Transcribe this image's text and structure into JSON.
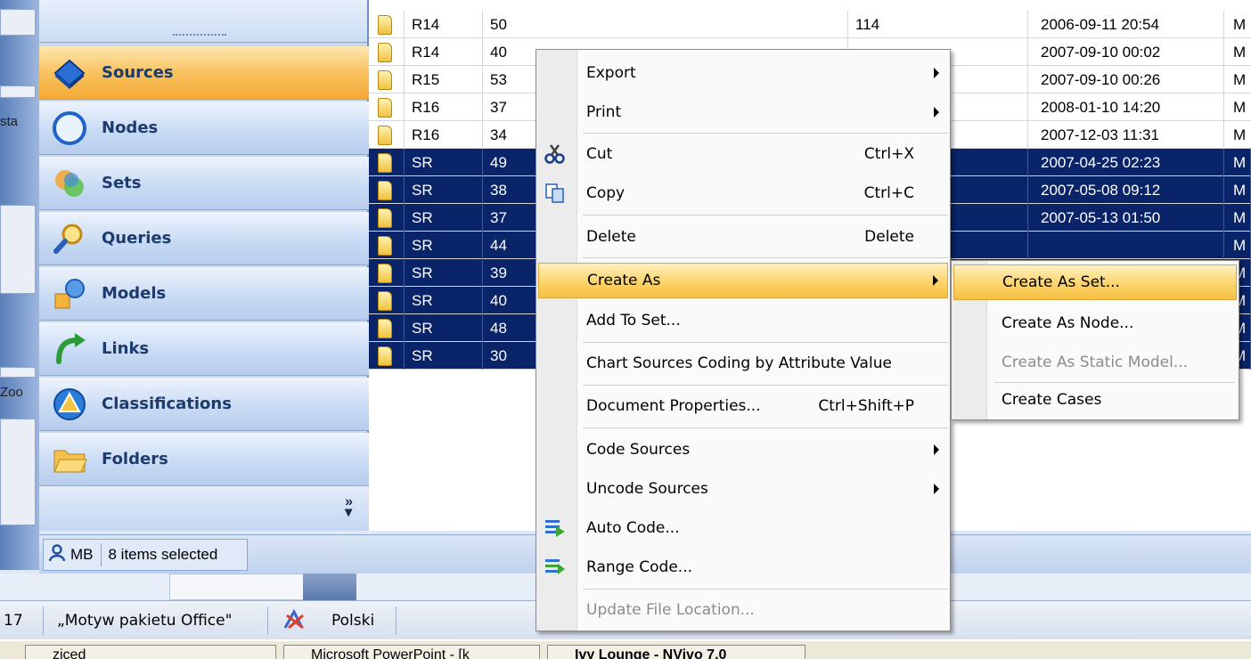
{
  "nav": {
    "items": [
      {
        "label": "Sources",
        "icon": "sources-icon",
        "active": true
      },
      {
        "label": "Nodes",
        "icon": "nodes-icon"
      },
      {
        "label": "Sets",
        "icon": "sets-icon"
      },
      {
        "label": "Queries",
        "icon": "queries-icon"
      },
      {
        "label": "Models",
        "icon": "models-icon"
      },
      {
        "label": "Links",
        "icon": "links-icon"
      },
      {
        "label": "Classifications",
        "icon": "classifications-icon"
      },
      {
        "label": "Folders",
        "icon": "folders-icon"
      }
    ],
    "more_chevron": "»"
  },
  "status": {
    "user": "MB",
    "selection": "8 items selected"
  },
  "grid": {
    "rows": [
      {
        "name": "R14",
        "num": "50",
        "refs": "114",
        "date": "2006-09-11 20:54",
        "by": "M",
        "selected": false
      },
      {
        "name": "R14",
        "num": "40",
        "refs": "",
        "date": "2007-09-10 00:02",
        "by": "M",
        "selected": false
      },
      {
        "name": "R15",
        "num": "53",
        "refs": "",
        "date": "2007-09-10 00:26",
        "by": "M",
        "selected": false
      },
      {
        "name": "R16",
        "num": "37",
        "refs": "",
        "date": "2008-01-10 14:20",
        "by": "M",
        "selected": false
      },
      {
        "name": "R16",
        "num": "34",
        "refs": "",
        "date": "2007-12-03 11:31",
        "by": "M",
        "selected": false
      },
      {
        "name": "SR",
        "num": "49",
        "refs": "",
        "date": "2007-04-25 02:23",
        "by": "M",
        "selected": true
      },
      {
        "name": "SR",
        "num": "38",
        "refs": "",
        "date": "2007-05-08 09:12",
        "by": "M",
        "selected": true
      },
      {
        "name": "SR",
        "num": "37",
        "refs": "",
        "date": "2007-05-13 01:50",
        "by": "M",
        "selected": true
      },
      {
        "name": "SR",
        "num": "44",
        "refs": "",
        "date": "",
        "by": "M",
        "selected": true
      },
      {
        "name": "SR",
        "num": "39",
        "refs": "",
        "date": "",
        "by": "M",
        "selected": true
      },
      {
        "name": "SR",
        "num": "40",
        "refs": "",
        "date": "",
        "by": "M",
        "selected": true
      },
      {
        "name": "SR",
        "num": "48",
        "refs": "",
        "date": "",
        "by": "M",
        "selected": true
      },
      {
        "name": "SR",
        "num": "30",
        "refs": "",
        "date": "",
        "by": "M",
        "selected": true
      }
    ]
  },
  "context_menu": {
    "export": "Export",
    "print": "Print",
    "cut": "Cut",
    "cut_shortcut": "Ctrl+X",
    "copy": "Copy",
    "copy_shortcut": "Ctrl+C",
    "delete": "Delete",
    "delete_shortcut": "Delete",
    "create_as": "Create As",
    "add_to_set": "Add To Set...",
    "chart_sources": "Chart Sources Coding by Attribute Value",
    "document_properties": "Document Properties...",
    "document_properties_shortcut": "Ctrl+Shift+P",
    "code_sources": "Code Sources",
    "uncode_sources": "Uncode Sources",
    "auto_code": "Auto Code...",
    "range_code": "Range Code...",
    "update_file_location": "Update File Location..."
  },
  "submenu": {
    "create_as_set": "Create As Set...",
    "create_as_node": "Create As Node...",
    "create_as_static_model": "Create As Static Model...",
    "create_cases": "Create Cases"
  },
  "office_bar": {
    "page_num": "17",
    "theme": "„Motyw pakietu Office\"",
    "language": "Polski"
  },
  "left_fragments": {
    "frag1": "sta",
    "frag2": "Zoo"
  },
  "taskbar": {
    "task1": "ziced",
    "task2": "Microsoft PowerPoint - [k",
    "task3": "Ivy Lounge - NVivo 7.0"
  },
  "colors": {
    "selection": "#0a246a",
    "menu_highlight": "#fcd46b",
    "nav_active": "#f9c261",
    "nav_bg": "#c6d9f3"
  }
}
